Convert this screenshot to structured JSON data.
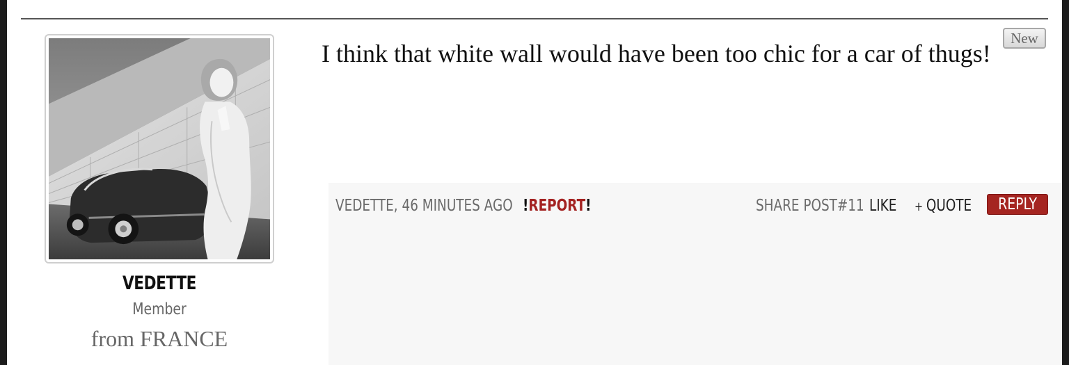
{
  "post": {
    "badge": "New",
    "message": "I think that white wall would have been too chic for a car of thugs!",
    "author": {
      "name": "VEDETTE",
      "role": "Member",
      "location": "from FRANCE",
      "avatar_icon": "avatar-photo"
    },
    "footer": {
      "author_time": "VEDETTE, 46 MINUTES AGO",
      "report_prefix": "!",
      "report_label": "REPORT",
      "report_suffix": "!",
      "share_label": "SHARE POST#11",
      "like_label": "LIKE",
      "quote_plus": "+",
      "quote_label": "QUOTE",
      "reply_label": "REPLY"
    }
  },
  "colors": {
    "accent_red": "#a52521",
    "page_bg": "#ffffff",
    "footer_bg": "#f7f7f7",
    "frame_bg": "#1c1c1c"
  }
}
